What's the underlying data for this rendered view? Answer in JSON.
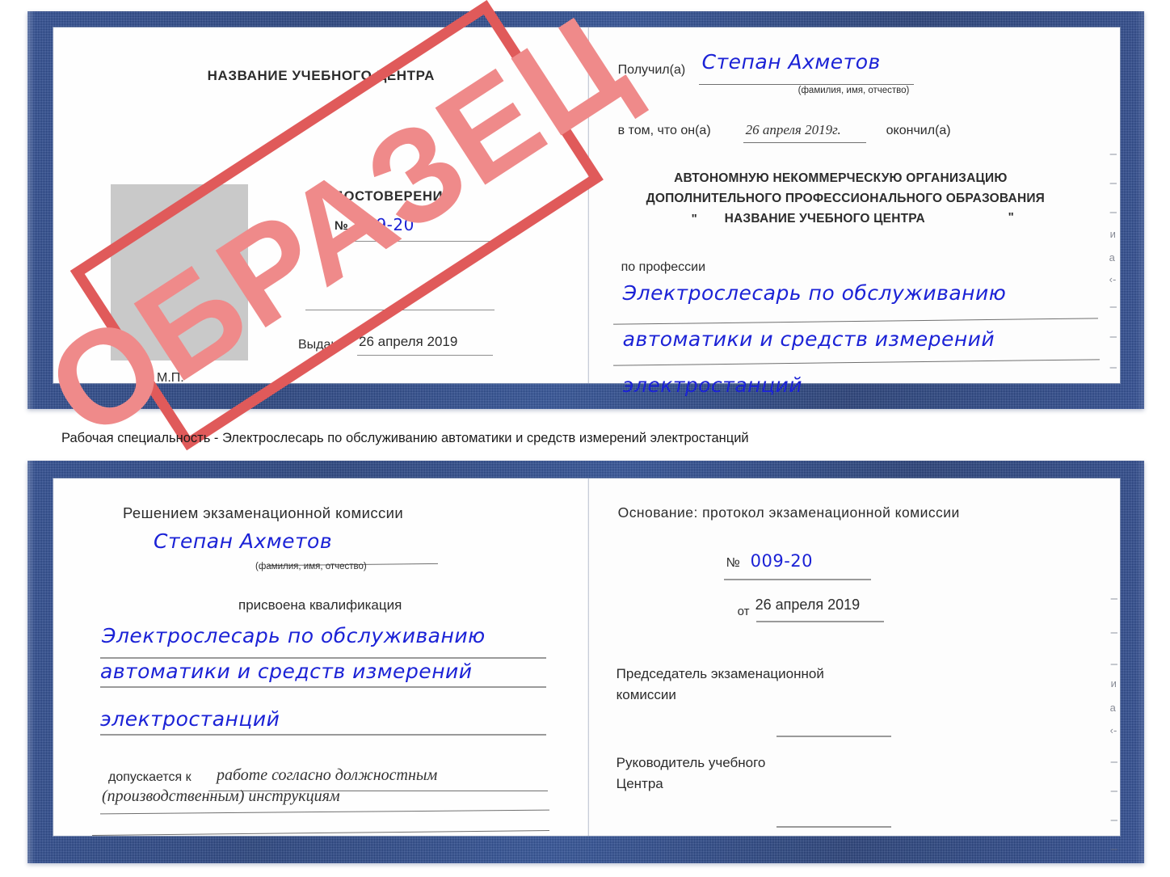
{
  "colors": {
    "cover_blue": "#27448a",
    "stamp_red": "#e05a5a",
    "handwriting_blue": "#1b22d6",
    "photo_placeholder_gray": "#c9c9c9",
    "rule_gray": "#8d8d8d"
  },
  "stamp": {
    "text": "ОБРАЗЕЦ",
    "rotation_deg": -33
  },
  "caption": {
    "text": "Рабочая специальность - Электрослесарь по обслуживанию автоматики и средств измерений электростанций"
  },
  "certificate_top": {
    "left_page": {
      "center_name": "НАЗВАНИЕ УЧЕБНОГО ЦЕНТРА",
      "doc_title": "УДОСТОВЕРЕНИЕ",
      "number_label": "№",
      "number_value": "009-20",
      "issued_label": "Выдано",
      "issued_value": "26 апреля 2019",
      "seal_label": "М.П."
    },
    "right_page": {
      "received_label": "Получил(а)",
      "received_value": "Степан Ахметов",
      "fio_hint": "(фамилия, имя, отчество)",
      "that_he_label": "в том, что он(а)",
      "that_he_value": "26 апреля 2019г.",
      "graduated_label": "окончил(а)",
      "org_line1": "АВТОНОМНУЮ НЕКОММЕРЧЕСКУЮ ОРГАНИЗАЦИЮ",
      "org_line2": "ДОПОЛНИТЕЛЬНОГО ПРОФЕССИОНАЛЬНОГО ОБРАЗОВАНИЯ",
      "org_quote_open": "\"",
      "org_line3": "НАЗВАНИЕ УЧЕБНОГО ЦЕНТРА",
      "org_quote_close": "\"",
      "profession_label": "по профессии",
      "profession_line1": "Электрослесарь по обслуживанию",
      "profession_line2": "автоматики и средств измерений",
      "profession_line3": "электростанций",
      "margin_marks": [
        "–",
        "–",
        "–",
        "и",
        "а",
        "‹-",
        "–",
        "–",
        "–"
      ]
    }
  },
  "certificate_bottom": {
    "left_page": {
      "heading": "Решением экзаменационной комиссии",
      "name_value": "Степан Ахметов",
      "fio_hint": "(фамилия, имя, отчество)",
      "qualification_label": "присвоена квалификация",
      "qualification_line1": "Электрослесарь по обслуживанию",
      "qualification_line2": "автоматики и средств измерений",
      "qualification_line3": "электростанций",
      "allowed_label": "допускается к",
      "allowed_value_line1": "работе согласно должностным",
      "allowed_value_line2": "(производственным) инструкциям"
    },
    "right_page": {
      "basis_label": "Основание: протокол экзаменационной комиссии",
      "number_label": "№",
      "number_value": "009-20",
      "date_label": "от",
      "date_value": "26 апреля 2019",
      "chairman_line1": "Председатель экзаменационной",
      "chairman_line2": "комиссии",
      "head_line1": "Руководитель учебного",
      "head_line2": "Центра",
      "margin_marks": [
        "–",
        "–",
        "–",
        "и",
        "а",
        "‹-",
        "–",
        "–",
        "–",
        "–"
      ]
    }
  }
}
